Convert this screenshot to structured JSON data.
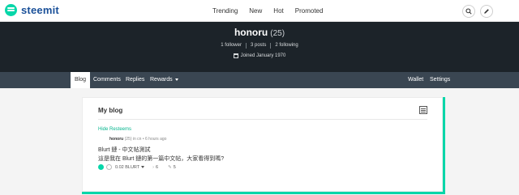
{
  "topbar": {
    "logo_text": "steemit",
    "nav": [
      "Trending",
      "New",
      "Hot",
      "Promoted"
    ]
  },
  "profile": {
    "name": "honoru",
    "reputation": "(25)",
    "followers": "1 follower",
    "posts": "3 posts",
    "following": "2 following",
    "joined": "Joined January 1970"
  },
  "subnav": {
    "blog": "Blog",
    "comments": "Comments",
    "replies": "Replies",
    "rewards": "Rewards",
    "wallet": "Wallet",
    "settings": "Settings"
  },
  "blog": {
    "title": "My blog",
    "hide_resteems": "Hide Resteems",
    "post": {
      "author": "honoru",
      "author_rep": "(25)",
      "category_time": "in cn • 6 hours ago",
      "title": "Blurt 鏈 - 中文帖測試",
      "body": "這是我在 Blurt 鏈的第一篇中文帖，大家看得到嗎?",
      "payout": "0.02 BLURT",
      "votes": "6",
      "comments": "5"
    }
  },
  "colors": {
    "accent": "#06d6a9",
    "banner_bg": "#1c2329",
    "subnav_bg": "#3a4652"
  }
}
